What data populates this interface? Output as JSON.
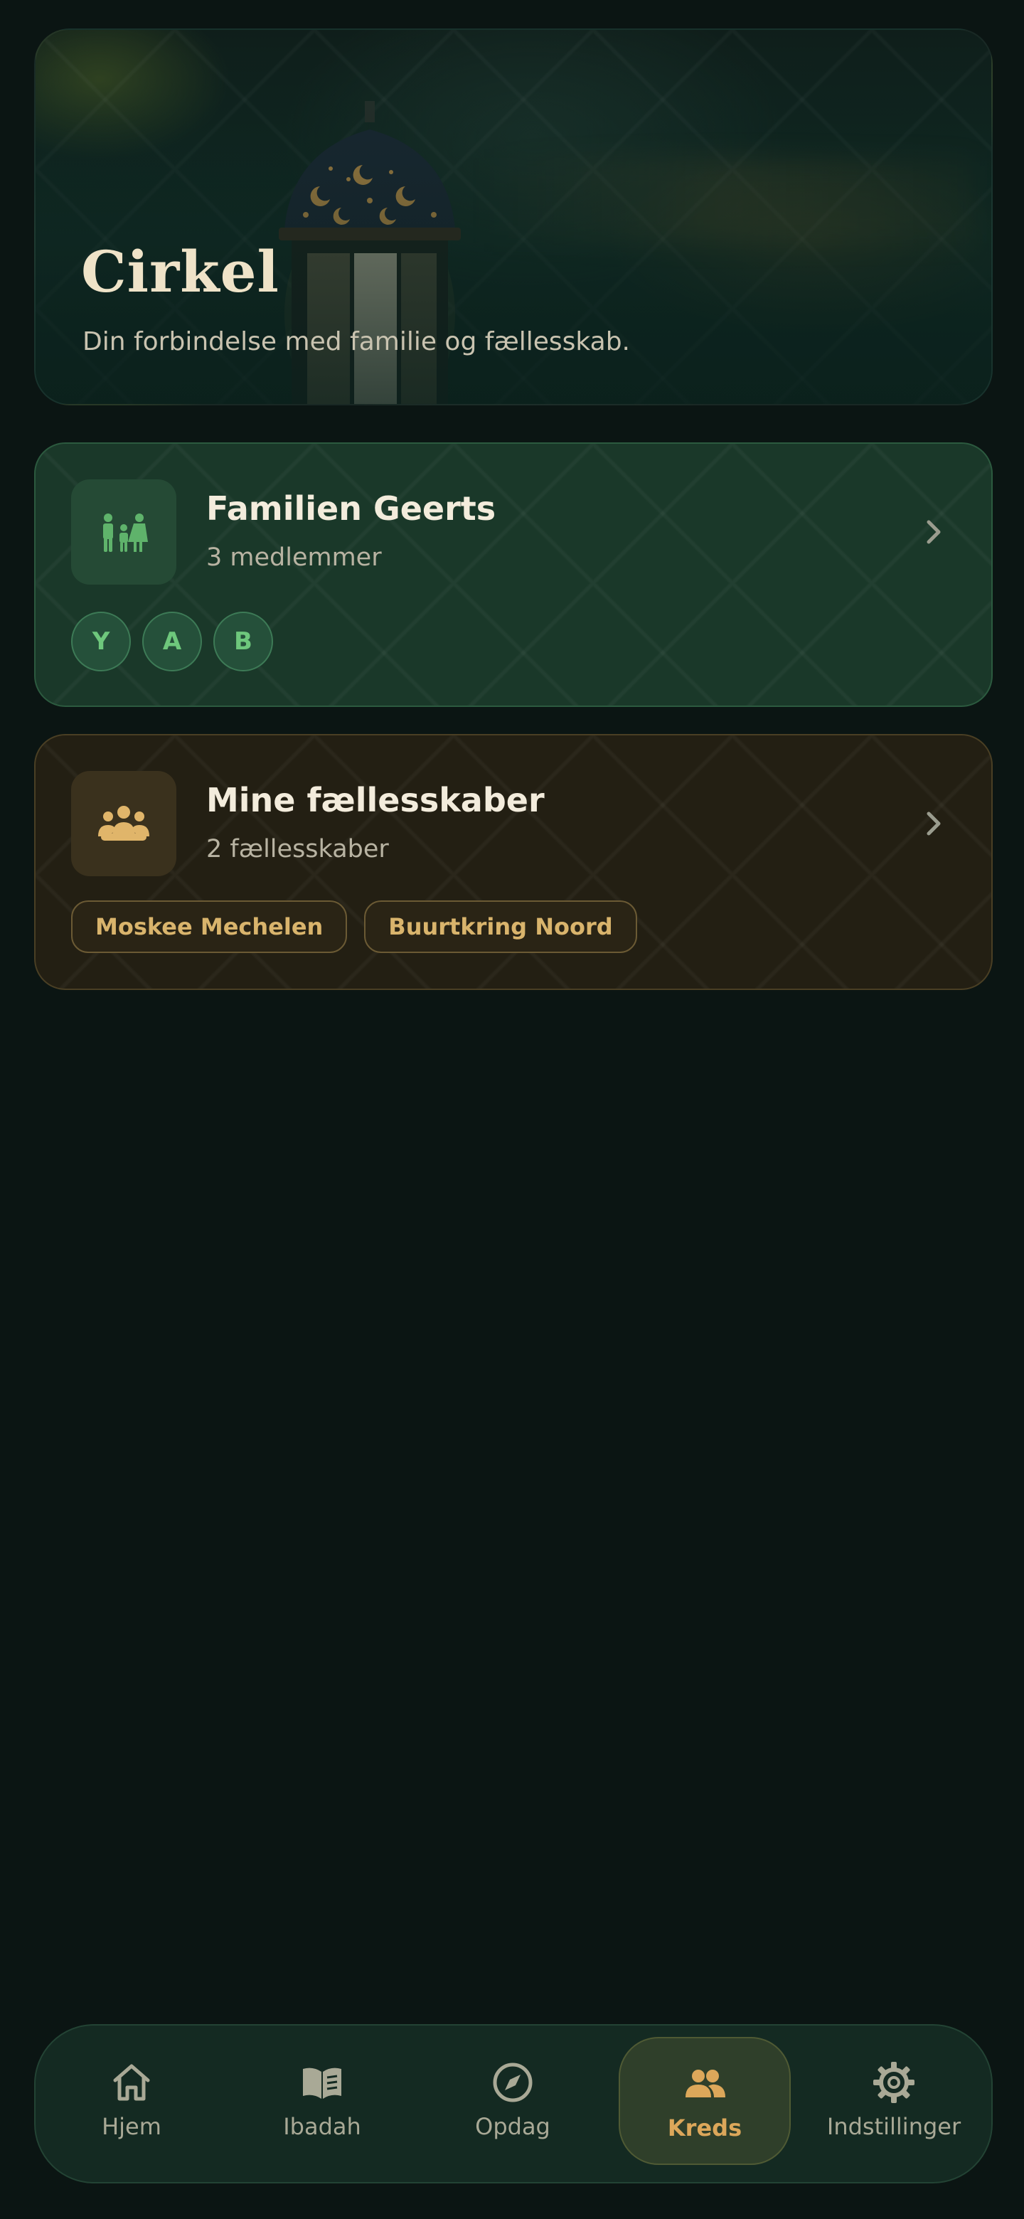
{
  "hero": {
    "title": "Cirkel",
    "subtitle": "Din forbindelse med familie og fællesskab."
  },
  "family_card": {
    "icon": "family-icon",
    "title": "Familien Geerts",
    "subtitle": "3 medlemmer",
    "members": [
      "Y",
      "A",
      "B"
    ]
  },
  "community_card": {
    "icon": "community-icon",
    "title": "Mine fællesskaber",
    "subtitle": "2 fællesskaber",
    "communities": [
      "Moskee Mechelen",
      "Buurtkring Noord"
    ]
  },
  "nav": {
    "items": [
      {
        "label": "Hjem",
        "icon": "home-icon"
      },
      {
        "label": "Ibadah",
        "icon": "book-icon"
      },
      {
        "label": "Opdag",
        "icon": "compass-icon"
      },
      {
        "label": "Kreds",
        "icon": "group-icon",
        "active": true
      },
      {
        "label": "Indstillinger",
        "icon": "gear-icon"
      }
    ]
  },
  "colors": {
    "background": "#0b1513",
    "accent_gold": "#dca75a",
    "accent_green": "#6ec77c"
  }
}
